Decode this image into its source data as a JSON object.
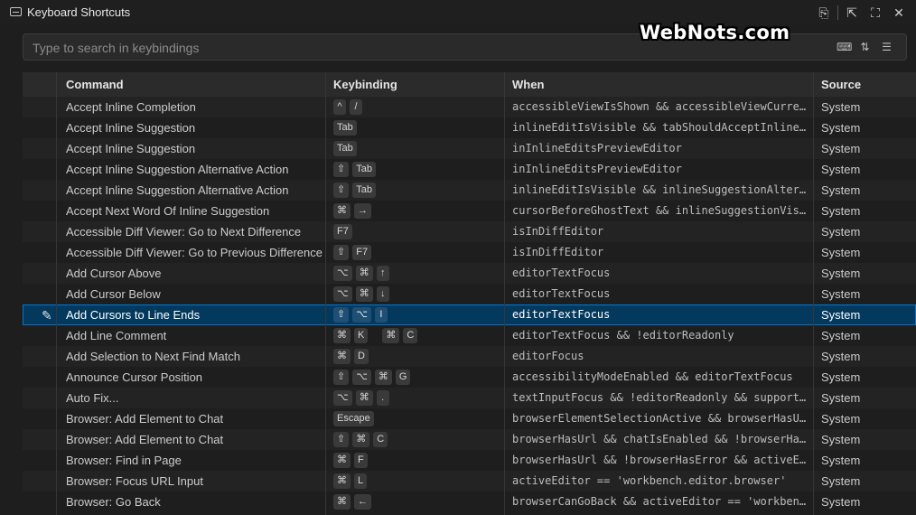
{
  "tab": {
    "title": "Keyboard Shortcuts"
  },
  "search": {
    "placeholder": "Type to search in keybindings"
  },
  "watermark": "WebNots.com",
  "columns": {
    "command": "Command",
    "keybinding": "Keybinding",
    "when": "When",
    "source": "Source"
  },
  "rows": [
    {
      "command": "Accept Inline Completion",
      "keys": [
        [
          "^",
          "/"
        ]
      ],
      "when": "accessibleViewIsShown && accessibleViewCurrentPr…",
      "source": "System"
    },
    {
      "command": "Accept Inline Suggestion",
      "keys": [
        [
          "Tab"
        ]
      ],
      "when": "inlineEditIsVisible && tabShouldAcceptInlineEdit…",
      "source": "System"
    },
    {
      "command": "Accept Inline Suggestion",
      "keys": [
        [
          "Tab"
        ]
      ],
      "when": "inInlineEditsPreviewEditor",
      "source": "System"
    },
    {
      "command": "Accept Inline Suggestion Alternative Action",
      "keys": [
        [
          "⇧",
          "Tab"
        ]
      ],
      "when": "inInlineEditsPreviewEditor",
      "source": "System"
    },
    {
      "command": "Accept Inline Suggestion Alternative Action",
      "keys": [
        [
          "⇧",
          "Tab"
        ]
      ],
      "when": "inlineEditIsVisible && inlineSuggestionAlternati…",
      "source": "System"
    },
    {
      "command": "Accept Next Word Of Inline Suggestion",
      "keys": [
        [
          "⌘",
          "→"
        ]
      ],
      "when": "cursorBeforeGhostText && inlineSuggestionVisible…",
      "source": "System"
    },
    {
      "command": "Accessible Diff Viewer: Go to Next Difference",
      "keys": [
        [
          "F7"
        ]
      ],
      "when": "isInDiffEditor",
      "source": "System"
    },
    {
      "command": "Accessible Diff Viewer: Go to Previous Difference",
      "keys": [
        [
          "⇧",
          "F7"
        ]
      ],
      "when": "isInDiffEditor",
      "source": "System"
    },
    {
      "command": "Add Cursor Above",
      "keys": [
        [
          "⌥",
          "⌘",
          "↑"
        ]
      ],
      "when": "editorTextFocus",
      "source": "System"
    },
    {
      "command": "Add Cursor Below",
      "keys": [
        [
          "⌥",
          "⌘",
          "↓"
        ]
      ],
      "when": "editorTextFocus",
      "source": "System"
    },
    {
      "command": "Add Cursors to Line Ends",
      "keys": [
        [
          "⇧",
          "⌥",
          "I"
        ]
      ],
      "when": "editorTextFocus",
      "source": "System",
      "selected": true
    },
    {
      "command": "Add Line Comment",
      "keys": [
        [
          "⌘",
          "K"
        ],
        [
          "⌘",
          "C"
        ]
      ],
      "when": "editorTextFocus && !editorReadonly",
      "source": "System"
    },
    {
      "command": "Add Selection to Next Find Match",
      "keys": [
        [
          "⌘",
          "D"
        ]
      ],
      "when": "editorFocus",
      "source": "System"
    },
    {
      "command": "Announce Cursor Position",
      "keys": [
        [
          "⇧",
          "⌥",
          "⌘",
          "G"
        ]
      ],
      "when": "accessibilityModeEnabled && editorTextFocus",
      "source": "System"
    },
    {
      "command": "Auto Fix...",
      "keys": [
        [
          "⌥",
          "⌘",
          "."
        ]
      ],
      "when": "textInputFocus && !editorReadonly && supportedCo…",
      "source": "System"
    },
    {
      "command": "Browser: Add Element to Chat",
      "keys": [
        [
          "Escape"
        ]
      ],
      "when": "browserElementSelectionActive && browserHasUrl &…",
      "source": "System"
    },
    {
      "command": "Browser: Add Element to Chat",
      "keys": [
        [
          "⇧",
          "⌘",
          "C"
        ]
      ],
      "when": "browserHasUrl && chatIsEnabled && !browserHasErr…",
      "source": "System"
    },
    {
      "command": "Browser: Find in Page",
      "keys": [
        [
          "⌘",
          "F"
        ]
      ],
      "when": "browserHasUrl && !browserHasError && activeEdito…",
      "source": "System"
    },
    {
      "command": "Browser: Focus URL Input",
      "keys": [
        [
          "⌘",
          "L"
        ]
      ],
      "when": "activeEditor == 'workbench.editor.browser'",
      "source": "System"
    },
    {
      "command": "Browser: Go Back",
      "keys": [
        [
          "⌘",
          "←"
        ]
      ],
      "when": "browserCanGoBack && activeEditor == 'workbench.e…",
      "source": "System"
    }
  ]
}
